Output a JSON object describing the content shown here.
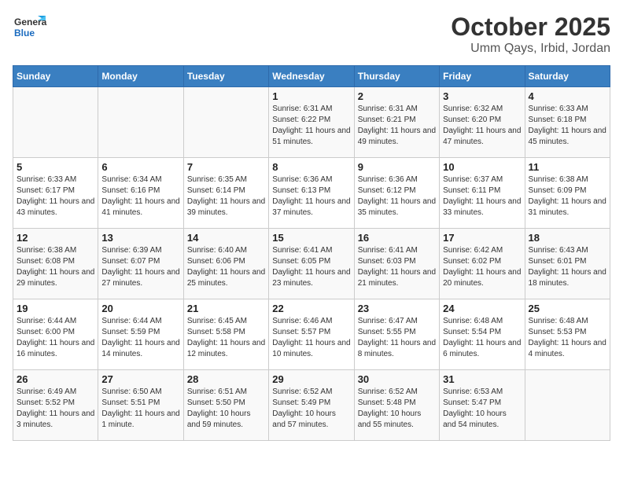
{
  "logo": {
    "line1": "General",
    "line2": "Blue"
  },
  "title": "October 2025",
  "subtitle": "Umm Qays, Irbid, Jordan",
  "weekdays": [
    "Sunday",
    "Monday",
    "Tuesday",
    "Wednesday",
    "Thursday",
    "Friday",
    "Saturday"
  ],
  "weeks": [
    [
      {
        "day": "",
        "info": ""
      },
      {
        "day": "",
        "info": ""
      },
      {
        "day": "",
        "info": ""
      },
      {
        "day": "1",
        "info": "Sunrise: 6:31 AM\nSunset: 6:22 PM\nDaylight: 11 hours and 51 minutes."
      },
      {
        "day": "2",
        "info": "Sunrise: 6:31 AM\nSunset: 6:21 PM\nDaylight: 11 hours and 49 minutes."
      },
      {
        "day": "3",
        "info": "Sunrise: 6:32 AM\nSunset: 6:20 PM\nDaylight: 11 hours and 47 minutes."
      },
      {
        "day": "4",
        "info": "Sunrise: 6:33 AM\nSunset: 6:18 PM\nDaylight: 11 hours and 45 minutes."
      }
    ],
    [
      {
        "day": "5",
        "info": "Sunrise: 6:33 AM\nSunset: 6:17 PM\nDaylight: 11 hours and 43 minutes."
      },
      {
        "day": "6",
        "info": "Sunrise: 6:34 AM\nSunset: 6:16 PM\nDaylight: 11 hours and 41 minutes."
      },
      {
        "day": "7",
        "info": "Sunrise: 6:35 AM\nSunset: 6:14 PM\nDaylight: 11 hours and 39 minutes."
      },
      {
        "day": "8",
        "info": "Sunrise: 6:36 AM\nSunset: 6:13 PM\nDaylight: 11 hours and 37 minutes."
      },
      {
        "day": "9",
        "info": "Sunrise: 6:36 AM\nSunset: 6:12 PM\nDaylight: 11 hours and 35 minutes."
      },
      {
        "day": "10",
        "info": "Sunrise: 6:37 AM\nSunset: 6:11 PM\nDaylight: 11 hours and 33 minutes."
      },
      {
        "day": "11",
        "info": "Sunrise: 6:38 AM\nSunset: 6:09 PM\nDaylight: 11 hours and 31 minutes."
      }
    ],
    [
      {
        "day": "12",
        "info": "Sunrise: 6:38 AM\nSunset: 6:08 PM\nDaylight: 11 hours and 29 minutes."
      },
      {
        "day": "13",
        "info": "Sunrise: 6:39 AM\nSunset: 6:07 PM\nDaylight: 11 hours and 27 minutes."
      },
      {
        "day": "14",
        "info": "Sunrise: 6:40 AM\nSunset: 6:06 PM\nDaylight: 11 hours and 25 minutes."
      },
      {
        "day": "15",
        "info": "Sunrise: 6:41 AM\nSunset: 6:05 PM\nDaylight: 11 hours and 23 minutes."
      },
      {
        "day": "16",
        "info": "Sunrise: 6:41 AM\nSunset: 6:03 PM\nDaylight: 11 hours and 21 minutes."
      },
      {
        "day": "17",
        "info": "Sunrise: 6:42 AM\nSunset: 6:02 PM\nDaylight: 11 hours and 20 minutes."
      },
      {
        "day": "18",
        "info": "Sunrise: 6:43 AM\nSunset: 6:01 PM\nDaylight: 11 hours and 18 minutes."
      }
    ],
    [
      {
        "day": "19",
        "info": "Sunrise: 6:44 AM\nSunset: 6:00 PM\nDaylight: 11 hours and 16 minutes."
      },
      {
        "day": "20",
        "info": "Sunrise: 6:44 AM\nSunset: 5:59 PM\nDaylight: 11 hours and 14 minutes."
      },
      {
        "day": "21",
        "info": "Sunrise: 6:45 AM\nSunset: 5:58 PM\nDaylight: 11 hours and 12 minutes."
      },
      {
        "day": "22",
        "info": "Sunrise: 6:46 AM\nSunset: 5:57 PM\nDaylight: 11 hours and 10 minutes."
      },
      {
        "day": "23",
        "info": "Sunrise: 6:47 AM\nSunset: 5:55 PM\nDaylight: 11 hours and 8 minutes."
      },
      {
        "day": "24",
        "info": "Sunrise: 6:48 AM\nSunset: 5:54 PM\nDaylight: 11 hours and 6 minutes."
      },
      {
        "day": "25",
        "info": "Sunrise: 6:48 AM\nSunset: 5:53 PM\nDaylight: 11 hours and 4 minutes."
      }
    ],
    [
      {
        "day": "26",
        "info": "Sunrise: 6:49 AM\nSunset: 5:52 PM\nDaylight: 11 hours and 3 minutes."
      },
      {
        "day": "27",
        "info": "Sunrise: 6:50 AM\nSunset: 5:51 PM\nDaylight: 11 hours and 1 minute."
      },
      {
        "day": "28",
        "info": "Sunrise: 6:51 AM\nSunset: 5:50 PM\nDaylight: 10 hours and 59 minutes."
      },
      {
        "day": "29",
        "info": "Sunrise: 6:52 AM\nSunset: 5:49 PM\nDaylight: 10 hours and 57 minutes."
      },
      {
        "day": "30",
        "info": "Sunrise: 6:52 AM\nSunset: 5:48 PM\nDaylight: 10 hours and 55 minutes."
      },
      {
        "day": "31",
        "info": "Sunrise: 6:53 AM\nSunset: 5:47 PM\nDaylight: 10 hours and 54 minutes."
      },
      {
        "day": "",
        "info": ""
      }
    ]
  ]
}
